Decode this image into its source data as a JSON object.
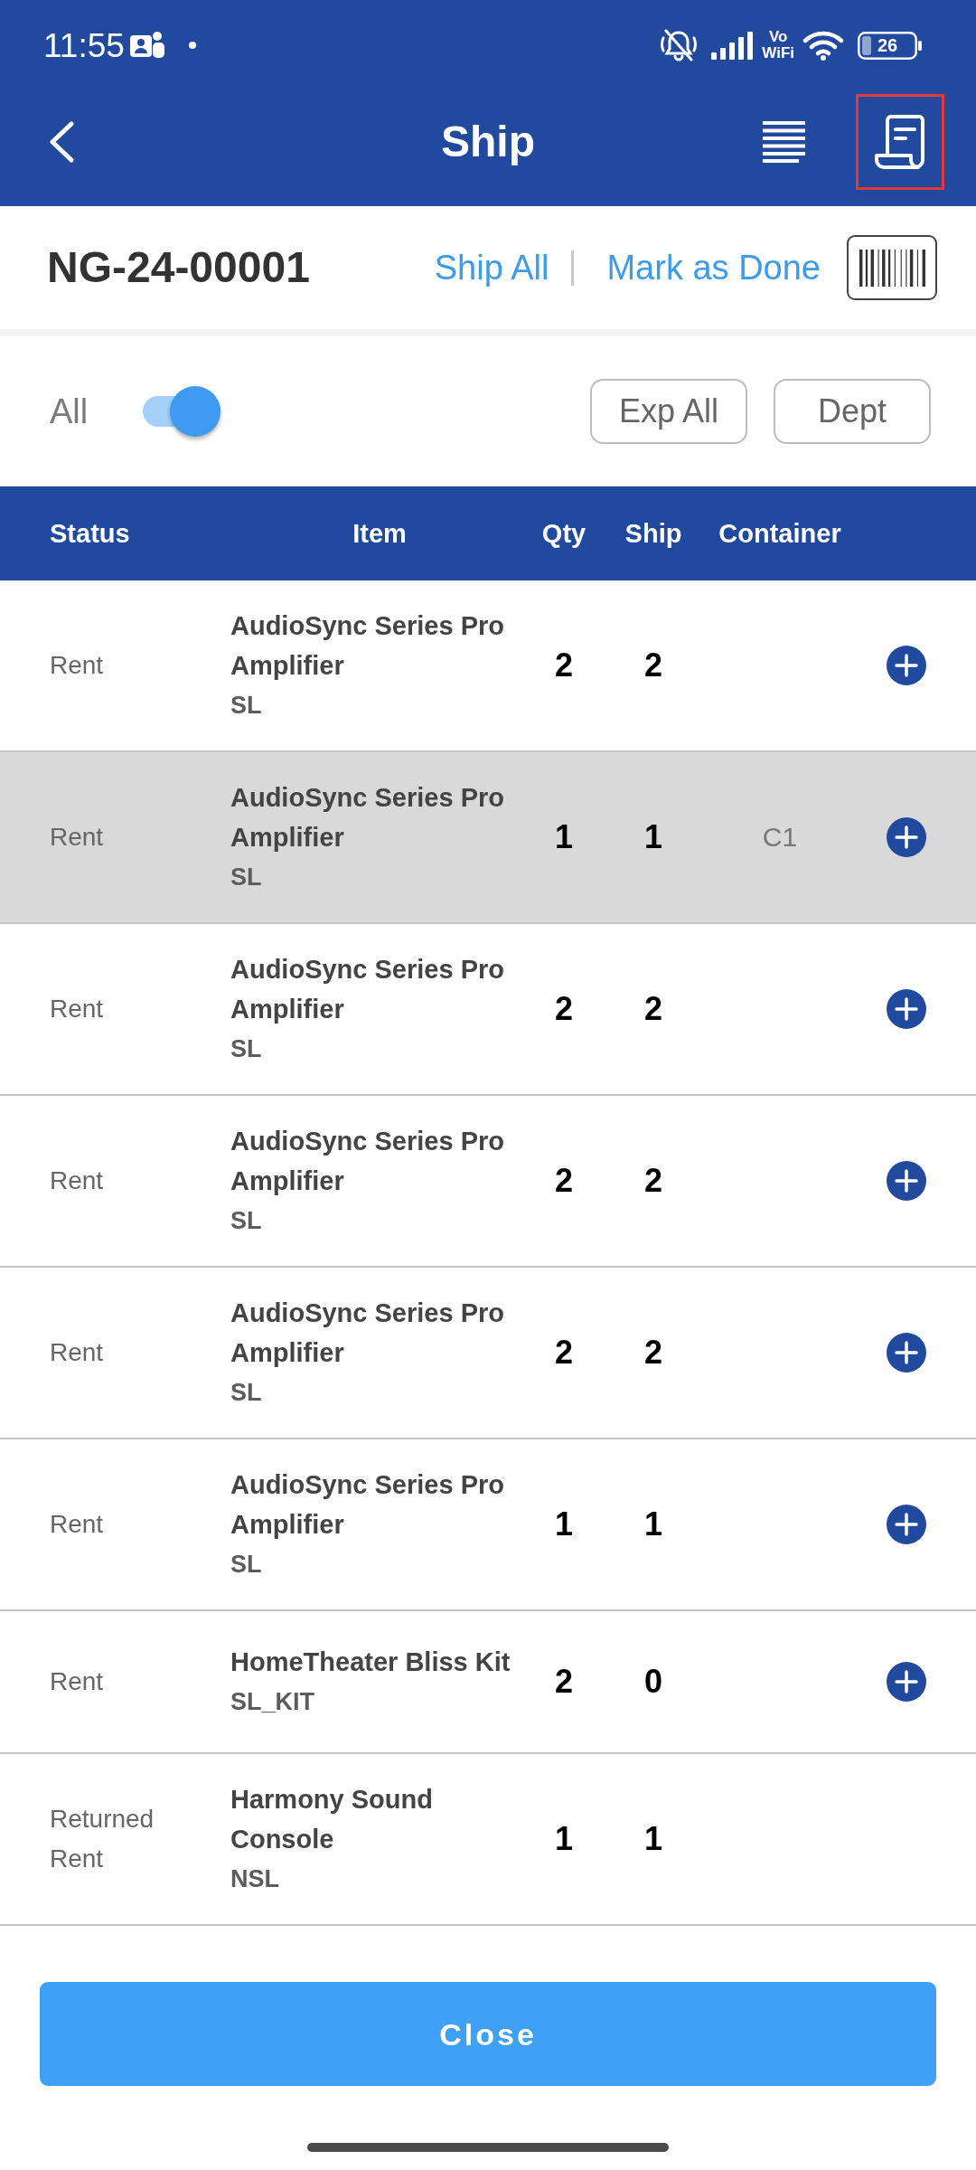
{
  "status_bar": {
    "time": "11:55",
    "network_label": [
      "Vo",
      "WiFi"
    ],
    "battery": "26"
  },
  "header": {
    "title": "Ship",
    "actions": [
      {
        "kind": "list",
        "highlighted": false
      },
      {
        "kind": "receipt",
        "highlighted": true
      }
    ]
  },
  "order": {
    "number": "NG-24-00001",
    "links": [
      "Ship All",
      "Mark as Done"
    ]
  },
  "filter": {
    "toggle": {
      "label": "All",
      "on": true
    },
    "buttons": [
      "Exp All",
      "Dept"
    ]
  },
  "table": {
    "columns": [
      "Status",
      "Item",
      "Qty",
      "Ship",
      "Container"
    ],
    "rows": [
      {
        "status": "Rent",
        "item": "AudioSync Series Pro Amplifier",
        "code": "SL",
        "qty": "2",
        "ship": "2",
        "selected": false,
        "add_button": true
      },
      {
        "status": "Rent",
        "item": "AudioSync Series Pro Amplifier",
        "code": "SL",
        "qty": "1",
        "ship": "1",
        "container": "C1",
        "selected": true,
        "add_button": true
      },
      {
        "status": "Rent",
        "item": "AudioSync Series Pro Amplifier",
        "code": "SL",
        "qty": "2",
        "ship": "2",
        "selected": false,
        "add_button": true
      },
      {
        "status": "Rent",
        "item": "AudioSync Series Pro Amplifier",
        "code": "SL",
        "qty": "2",
        "ship": "2",
        "selected": false,
        "add_button": true
      },
      {
        "status": "Rent",
        "item": "AudioSync Series Pro Amplifier",
        "code": "SL",
        "qty": "2",
        "ship": "2",
        "selected": false,
        "add_button": true
      },
      {
        "status": "Rent",
        "item": "AudioSync Series Pro Amplifier",
        "code": "SL",
        "qty": "1",
        "ship": "1",
        "selected": false,
        "add_button": true
      },
      {
        "status": "Rent",
        "item": "HomeTheater Bliss Kit",
        "code": "SL_KIT",
        "qty": "2",
        "ship": "0",
        "selected": false,
        "add_button": true
      },
      {
        "status": "Returned Rent",
        "item": "Harmony Sound Console",
        "code": "NSL",
        "qty": "1",
        "ship": "1",
        "selected": false,
        "add_button": false
      }
    ]
  },
  "footer": {
    "button": "Close"
  }
}
